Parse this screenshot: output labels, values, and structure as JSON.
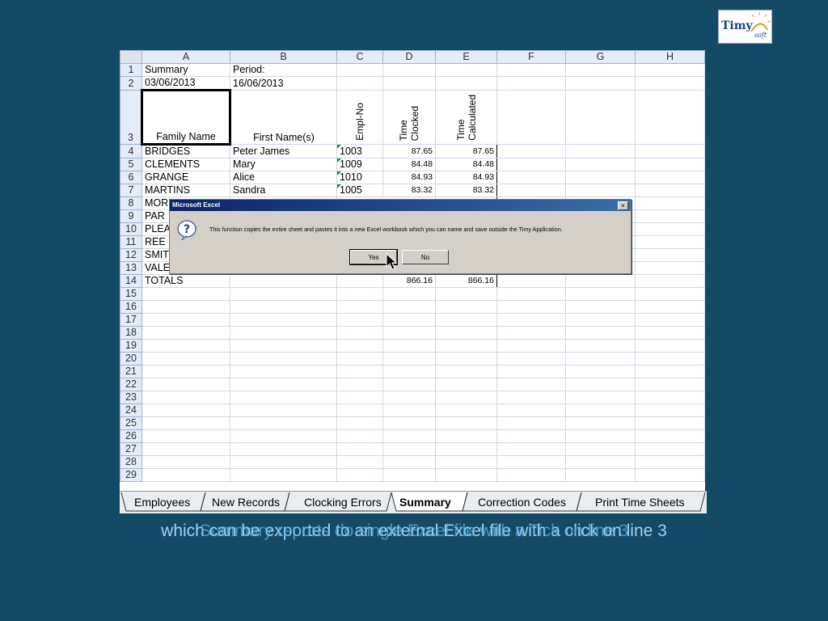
{
  "logo": {
    "text": "Timy",
    "sub": "soft"
  },
  "columns": [
    "A",
    "B",
    "C",
    "D",
    "E",
    "F",
    "G",
    "H"
  ],
  "rows": [
    {
      "n": "1",
      "a": "Summary",
      "b": "Period:",
      "c": "",
      "d": "",
      "e": ""
    },
    {
      "n": "2",
      "a": "03/06/2013",
      "b": "16/06/2013",
      "c": "",
      "d": "",
      "e": ""
    },
    {
      "n": "3",
      "a": "Family Name",
      "b": "First Name(s)",
      "c": "Empl-No",
      "d": "Time\nClocked",
      "e": "Time\nCalculated"
    },
    {
      "n": "4",
      "a": "BRIDGES",
      "b": "Peter James",
      "c": "1003",
      "d": "87.65",
      "e": "87.65"
    },
    {
      "n": "5",
      "a": "CLEMENTS",
      "b": "Mary",
      "c": "1009",
      "d": "84.48",
      "e": "84.48"
    },
    {
      "n": "6",
      "a": "GRANGE",
      "b": "Alice",
      "c": "1010",
      "d": "84.93",
      "e": "84.93"
    },
    {
      "n": "7",
      "a": "MARTINS",
      "b": "Sandra",
      "c": "1005",
      "d": "83.32",
      "e": "83.32"
    },
    {
      "n": "8",
      "a": "MOR",
      "b": "",
      "c": "",
      "d": "",
      "e": ""
    },
    {
      "n": "9",
      "a": "PAR",
      "b": "",
      "c": "",
      "d": "",
      "e": ""
    },
    {
      "n": "10",
      "a": "PLEA",
      "b": "",
      "c": "",
      "d": "",
      "e": ""
    },
    {
      "n": "11",
      "a": "REE",
      "b": "",
      "c": "",
      "d": "",
      "e": ""
    },
    {
      "n": "12",
      "a": "SMIT",
      "b": "",
      "c": "",
      "d": "",
      "e": ""
    },
    {
      "n": "13",
      "a": "VALE",
      "b": "",
      "c": "",
      "d": "",
      "e": ""
    },
    {
      "n": "14",
      "a": "TOTALS",
      "b": "",
      "c": "",
      "d": "866.16",
      "e": "866.16"
    },
    {
      "n": "15",
      "a": "",
      "b": "",
      "c": "",
      "d": "",
      "e": ""
    },
    {
      "n": "16",
      "a": "",
      "b": "",
      "c": "",
      "d": "",
      "e": ""
    },
    {
      "n": "17",
      "a": "",
      "b": "",
      "c": "",
      "d": "",
      "e": ""
    },
    {
      "n": "18",
      "a": "",
      "b": "",
      "c": "",
      "d": "",
      "e": ""
    },
    {
      "n": "19",
      "a": "",
      "b": "",
      "c": "",
      "d": "",
      "e": ""
    },
    {
      "n": "20",
      "a": "",
      "b": "",
      "c": "",
      "d": "",
      "e": ""
    },
    {
      "n": "21",
      "a": "",
      "b": "",
      "c": "",
      "d": "",
      "e": ""
    },
    {
      "n": "22",
      "a": "",
      "b": "",
      "c": "",
      "d": "",
      "e": ""
    },
    {
      "n": "23",
      "a": "",
      "b": "",
      "c": "",
      "d": "",
      "e": ""
    },
    {
      "n": "24",
      "a": "",
      "b": "",
      "c": "",
      "d": "",
      "e": ""
    },
    {
      "n": "25",
      "a": "",
      "b": "",
      "c": "",
      "d": "",
      "e": ""
    },
    {
      "n": "26",
      "a": "",
      "b": "",
      "c": "",
      "d": "",
      "e": ""
    },
    {
      "n": "27",
      "a": "",
      "b": "",
      "c": "",
      "d": "",
      "e": ""
    },
    {
      "n": "28",
      "a": "",
      "b": "",
      "c": "",
      "d": "",
      "e": ""
    },
    {
      "n": "29",
      "a": "",
      "b": "",
      "c": "",
      "d": "",
      "e": ""
    }
  ],
  "sheet_tabs": [
    {
      "label": "Employees",
      "active": false
    },
    {
      "label": "New Records",
      "active": false
    },
    {
      "label": "Clocking Errors",
      "active": false
    },
    {
      "label": "Summary",
      "active": true
    },
    {
      "label": "Correction Codes",
      "active": false
    },
    {
      "label": "Print Time Sheets",
      "active": false
    }
  ],
  "dialog": {
    "title": "Microsoft Excel",
    "close": "×",
    "message": "This function copies the entire sheet and pastes it into a new Excel workbook which you can name and save outside the Timy Application.",
    "yes_label": "Yes",
    "no_label": "No",
    "icon": "question-icon"
  },
  "captions": [
    "which can be exported to an external Excel file with a click on line 3",
    "Summary reports do single Excel file with a Tick on line 3"
  ],
  "colors": {
    "background": "#144a66",
    "caption": "#9fd3f2",
    "titlebar": "#0a246a",
    "header": "#e4ecf7"
  }
}
